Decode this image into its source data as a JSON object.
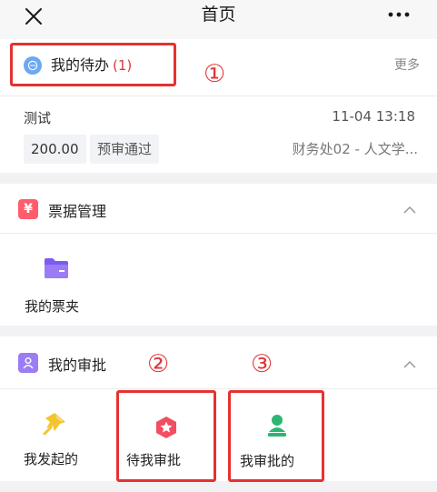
{
  "header": {
    "title": "首页"
  },
  "todo": {
    "title": "我的待办",
    "count": "(1)",
    "more": "更多",
    "marker": "①",
    "item": {
      "name": "测试",
      "time": "11-04 13:18",
      "amount": "200.00",
      "status": "预审通过",
      "department": "财务处02 - 人文学..."
    }
  },
  "tickets": {
    "title": "票据管理",
    "icon_glyph": "¥",
    "items": [
      {
        "label": "我的票夹"
      }
    ]
  },
  "approvals": {
    "title": "我的审批",
    "markers": [
      "②",
      "③"
    ],
    "items": [
      {
        "label": "我发起的"
      },
      {
        "label": "待我审批"
      },
      {
        "label": "我审批的"
      }
    ]
  },
  "colors": {
    "highlight": "#e63131",
    "todo_icon": "#6ba8f5",
    "ticket_icon": "#ff5c6c",
    "approval_icon": "#9b7cf5",
    "folder": "#7b5cf0",
    "pin": "#f4c430",
    "star": "#f24d61",
    "person": "#2bb673"
  }
}
